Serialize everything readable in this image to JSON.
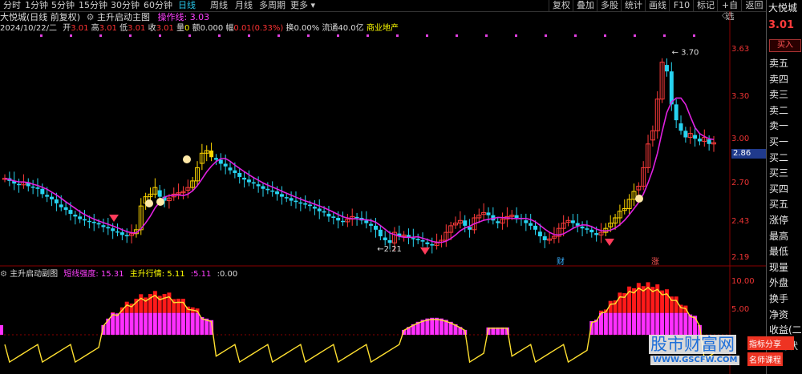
{
  "toolbar": {
    "periods": [
      "分时",
      "1分钟",
      "5分钟",
      "15分钟",
      "30分钟",
      "60分钟",
      "日线",
      "周线",
      "月线",
      "多周期",
      "更多"
    ],
    "active_period": "日线",
    "right_buttons": [
      "复权",
      "叠加",
      "多股",
      "统计",
      "画线",
      "F10",
      "标记",
      "+自选",
      "返回"
    ]
  },
  "header": {
    "stock_label": "大悦城(日线 前复权)",
    "indicator_name": "主升启动主图",
    "op_label": "操作线:",
    "op_value": "3.03",
    "date": "2024/10/22/二",
    "open_label": "开",
    "open": "3.01",
    "high_label": "高",
    "high": "3.01",
    "low_label": "低",
    "low": "3.01",
    "close_label": "收",
    "close": "3.01",
    "vol_label": "量",
    "vol": "0",
    "amount_label": "额",
    "amount": "0.000",
    "change_label": "幅",
    "change": "0.01(0.33%)",
    "turnover_label": "换",
    "turnover": "0.00%",
    "float_label": "流通",
    "float": "40.0亿",
    "sector": "商业地产"
  },
  "sub_header": {
    "name": "主升启动副图",
    "short_label": "短线强度:",
    "short_value": "15.31",
    "main_label": "主升行情:",
    "main_value": "5.11",
    "val2": ":5.11",
    "val3": ":0.00"
  },
  "price_axis": [
    "3.63",
    "3.30",
    "3.00",
    "2.70",
    "2.43",
    "2.19"
  ],
  "current_price": "2.86",
  "sub_axis": [
    "10.00",
    "5.00"
  ],
  "annotations": {
    "high": "3.70",
    "low": "2.21",
    "cai": "财",
    "zhang": "涨"
  },
  "right_panel": {
    "name": "大悦城",
    "price": "3.01",
    "buy_button": "买入",
    "items": [
      "卖五",
      "卖四",
      "卖三",
      "卖二",
      "卖一",
      "买一",
      "买二",
      "买三",
      "买四",
      "买五",
      "涨停",
      "最高",
      "最低",
      "现量",
      "外盘",
      "换手",
      "净资",
      "收益(二)",
      "交易状"
    ]
  },
  "watermark": {
    "line1": "股市财富网",
    "line2": "WWW.GSCFW.COM",
    "tag1": "指标分享",
    "tag2": "名师课程"
  },
  "chart_data": {
    "type": "candlestick",
    "closes": [
      2.74,
      2.72,
      2.7,
      2.69,
      2.71,
      2.68,
      2.67,
      2.66,
      2.62,
      2.6,
      2.58,
      2.55,
      2.52,
      2.5,
      2.47,
      2.45,
      2.43,
      2.42,
      2.41,
      2.4,
      2.39,
      2.37,
      2.36,
      2.34,
      2.33,
      2.31,
      2.3,
      2.32,
      2.35,
      2.53,
      2.6,
      2.62,
      2.67,
      2.6,
      2.57,
      2.59,
      2.62,
      2.63,
      2.64,
      2.67,
      2.72,
      2.82,
      2.93,
      2.95,
      2.9,
      2.88,
      2.85,
      2.83,
      2.8,
      2.78,
      2.75,
      2.73,
      2.71,
      2.7,
      2.68,
      2.66,
      2.65,
      2.64,
      2.62,
      2.6,
      2.59,
      2.57,
      2.56,
      2.55,
      2.54,
      2.53,
      2.51,
      2.49,
      2.48,
      2.45,
      2.44,
      2.42,
      2.41,
      2.43,
      2.45,
      2.44,
      2.42,
      2.4,
      2.38,
      2.35,
      2.3,
      2.27,
      2.25,
      2.33,
      2.3,
      2.31,
      2.29,
      2.28,
      2.27,
      2.26,
      2.24,
      2.23,
      2.25,
      2.27,
      2.33,
      2.38,
      2.4,
      2.42,
      2.38,
      2.35,
      2.44,
      2.46,
      2.48,
      2.46,
      2.42,
      2.4,
      2.43,
      2.45,
      2.46,
      2.44,
      2.43,
      2.4,
      2.38,
      2.35,
      2.3,
      2.27,
      2.28,
      2.3,
      2.36,
      2.4,
      2.42,
      2.4,
      2.38,
      2.36,
      2.35,
      2.33,
      2.31,
      2.33,
      2.36,
      2.4,
      2.44,
      2.49,
      2.51,
      2.58,
      2.64,
      2.68,
      2.82,
      3.0,
      3.1,
      3.34,
      3.62,
      3.55,
      3.3,
      3.18,
      3.1,
      3.05,
      3.08,
      3.04,
      3.02,
      3.05,
      3.0,
      3.01
    ]
  }
}
